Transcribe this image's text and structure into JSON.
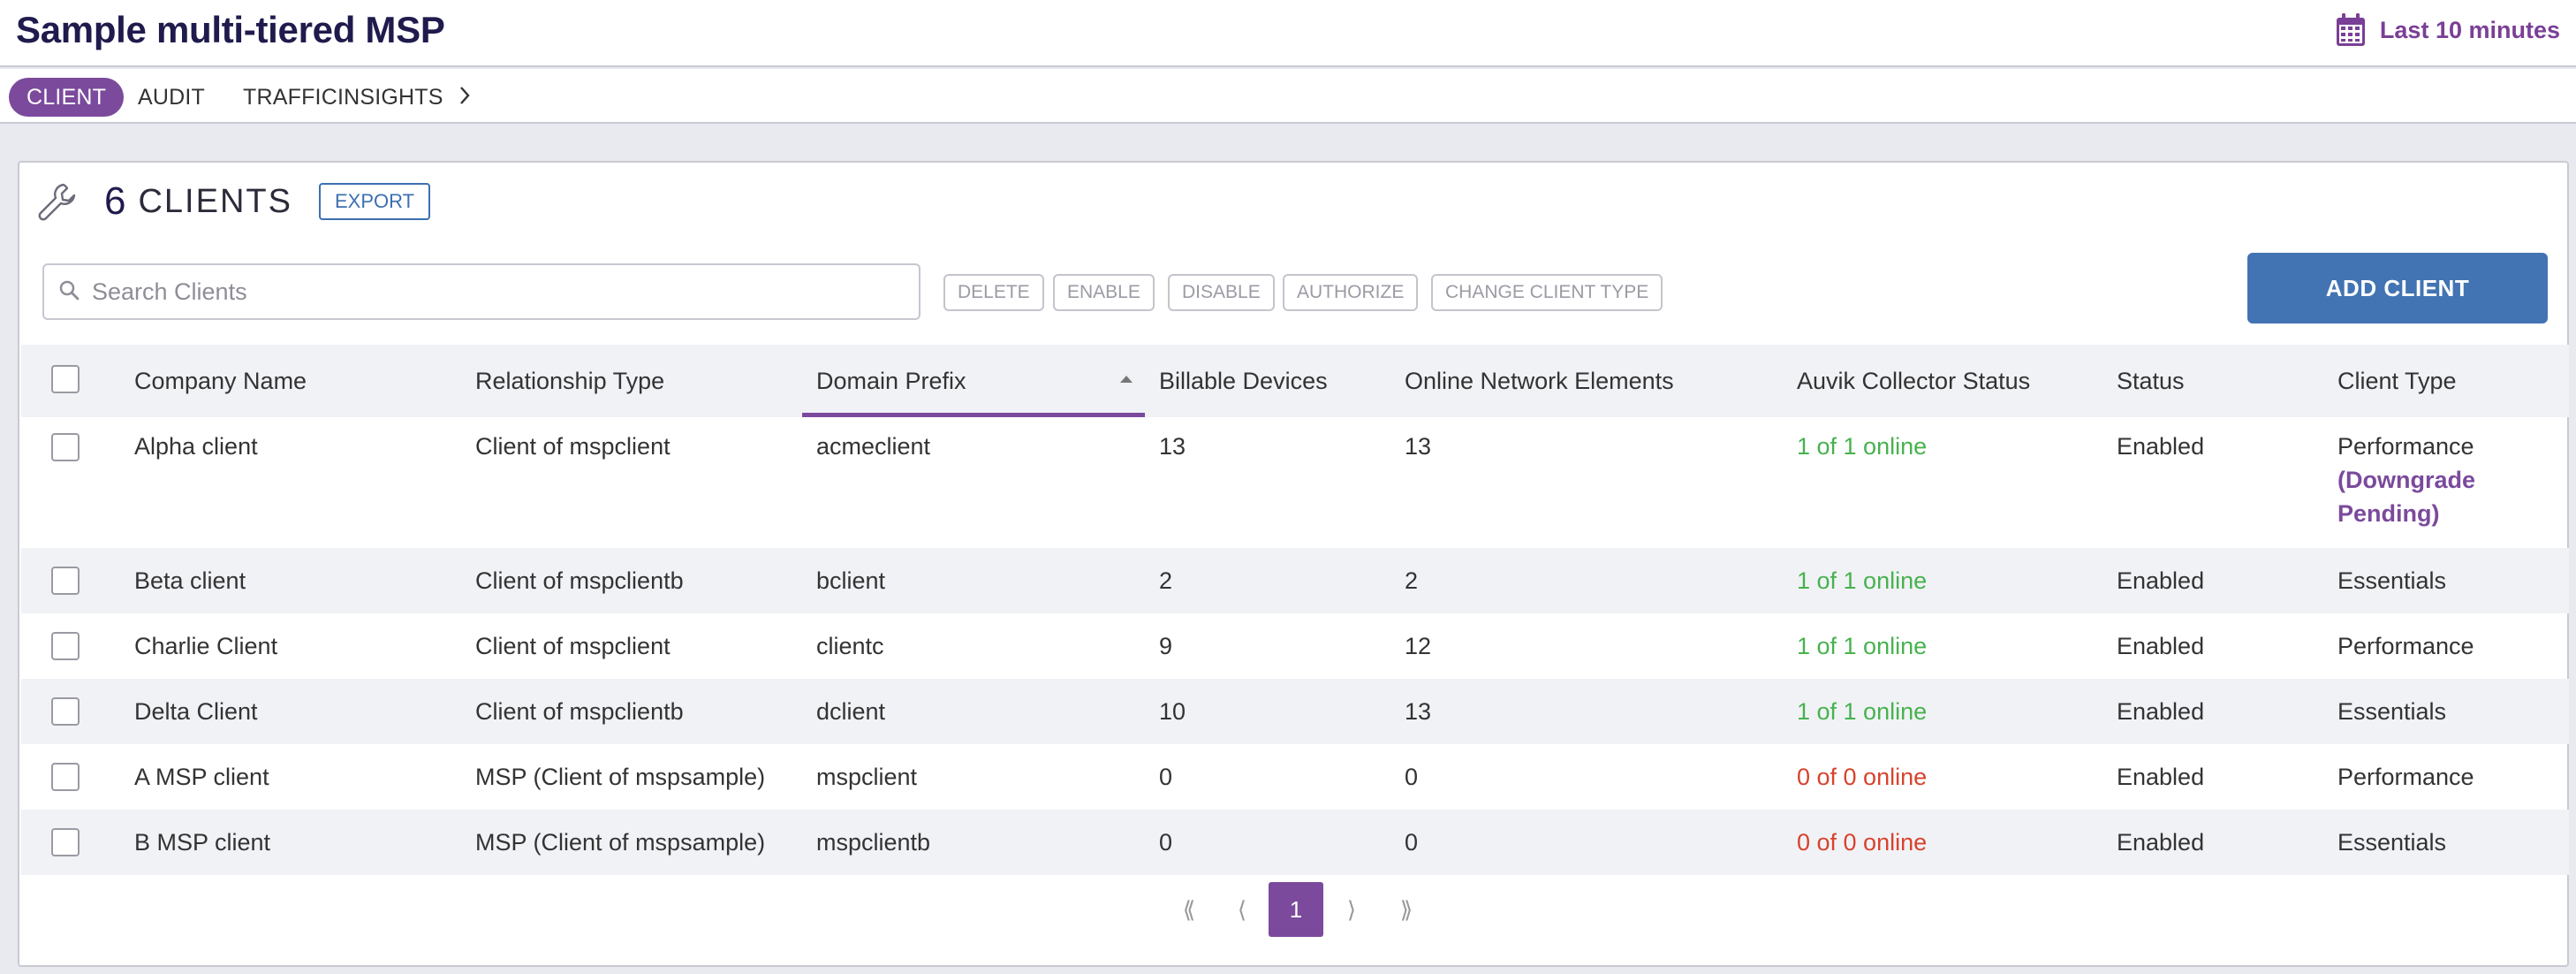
{
  "header": {
    "title": "Sample multi-tiered MSP",
    "time_range": "Last 10 minutes"
  },
  "tabs": [
    {
      "label": "CLIENT",
      "active": true
    },
    {
      "label": "AUDIT",
      "active": false
    },
    {
      "label": "TRAFFICINSIGHTS",
      "active": false
    }
  ],
  "card": {
    "count": "6",
    "count_label": "CLIENTS",
    "export_label": "EXPORT",
    "search_placeholder": "Search Clients",
    "actions": [
      "DELETE",
      "ENABLE",
      "DISABLE",
      "AUTHORIZE",
      "CHANGE CLIENT TYPE"
    ],
    "add_label": "ADD CLIENT"
  },
  "table": {
    "columns": [
      "Company Name",
      "Relationship Type",
      "Domain Prefix",
      "Billable Devices",
      "Online Network Elements",
      "Auvik Collector Status",
      "Status",
      "Client Type"
    ],
    "sorted_column": "Domain Prefix",
    "rows": [
      {
        "company": "Alpha client",
        "relationship": "Client of mspclient",
        "domain": "acmeclient",
        "billable": "13",
        "online": "13",
        "collector": "1 of 1 online",
        "collector_state": "ok",
        "status": "Enabled",
        "client_type": "Performance",
        "client_type_note": "(Downgrade Pending)"
      },
      {
        "company": "Beta client",
        "relationship": "Client of mspclientb",
        "domain": "bclient",
        "billable": "2",
        "online": "2",
        "collector": "1 of 1 online",
        "collector_state": "ok",
        "status": "Enabled",
        "client_type": "Essentials"
      },
      {
        "company": "Charlie Client",
        "relationship": "Client of mspclient",
        "domain": "clientc",
        "billable": "9",
        "online": "12",
        "collector": "1 of 1 online",
        "collector_state": "ok",
        "status": "Enabled",
        "client_type": "Performance"
      },
      {
        "company": "Delta Client",
        "relationship": "Client of mspclientb",
        "domain": "dclient",
        "billable": "10",
        "online": "13",
        "collector": "1 of 1 online",
        "collector_state": "ok",
        "status": "Enabled",
        "client_type": "Essentials"
      },
      {
        "company": "A MSP client",
        "relationship": "MSP (Client of mspsample)",
        "domain": "mspclient",
        "billable": "0",
        "online": "0",
        "collector": "0 of 0 online",
        "collector_state": "bad",
        "status": "Enabled",
        "client_type": "Performance"
      },
      {
        "company": "B MSP client",
        "relationship": "MSP (Client of mspsample)",
        "domain": "mspclientb",
        "billable": "0",
        "online": "0",
        "collector": "0 of 0 online",
        "collector_state": "bad",
        "status": "Enabled",
        "client_type": "Essentials"
      }
    ]
  },
  "pagination": {
    "first": "⟪",
    "prev": "⟨",
    "current": "1",
    "next": "⟩",
    "last": "⟫"
  },
  "colors": {
    "accent": "#7b4a9c",
    "primary_button": "#4274b3",
    "title": "#1f1b4d",
    "online_ok": "#47b24e",
    "online_bad": "#d8432c"
  }
}
